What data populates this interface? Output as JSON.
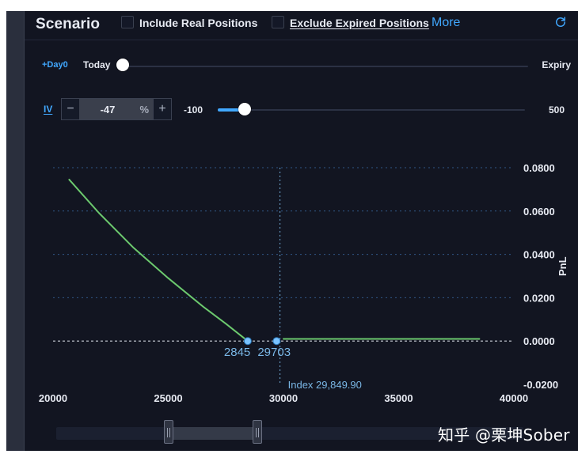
{
  "header": {
    "title": "Scenario",
    "include_real_positions_label": "Include Real Positions",
    "exclude_expired_positions_label": "Exclude Expired Positions",
    "more_label": "More",
    "refresh_icon": "refresh-icon"
  },
  "time_slider": {
    "left_tag": "+Day0",
    "left_label": "Today",
    "right_label": "Expiry",
    "value_fraction": 0.0
  },
  "iv_control": {
    "label": "IV",
    "minus_label": "−",
    "value": "-47",
    "percent_label": "%",
    "plus_label": "+",
    "min_label": "-100",
    "max_label": "500",
    "current_value": -47,
    "min_value": -100,
    "max_value": 500
  },
  "chart": {
    "ylabel": "PnL",
    "index_label": "Index 29,849.90",
    "breakeven_labels": [
      "2845",
      "29703"
    ]
  },
  "chart_data": {
    "type": "line",
    "xlim": [
      20000,
      40000
    ],
    "ylim": [
      -0.02,
      0.08
    ],
    "x_ticks": [
      "20000",
      "25000",
      "30000",
      "35000",
      "40000"
    ],
    "y_ticks": [
      "0.0800",
      "0.0600",
      "0.0400",
      "0.0200",
      "0.0000",
      "-0.0200"
    ],
    "ylabel": "PnL",
    "index_x": 29849.9,
    "series": [
      {
        "x": [
          20700,
          22000,
          23500,
          25000,
          26500,
          27500,
          28450,
          29703,
          30000,
          34000,
          38500
        ],
        "y": [
          0.0745,
          0.059,
          0.043,
          0.029,
          0.016,
          0.008,
          0.0,
          0.0,
          0.001,
          0.001,
          0.001
        ]
      }
    ],
    "points": [
      {
        "x": 28450,
        "y": 0.0,
        "label": "2845"
      },
      {
        "x": 29703,
        "y": 0.0,
        "label": "29703"
      }
    ],
    "grid": true,
    "colors": {
      "line": "#6cc96e",
      "accent": "#41a8ff",
      "grid": "#3a6ea8",
      "zero_line": "#d9dde6"
    }
  },
  "range_slider": {
    "start_fraction": 0.24,
    "end_fraction": 0.43
  },
  "watermark": {
    "text": "知乎 @栗坤Sober"
  }
}
